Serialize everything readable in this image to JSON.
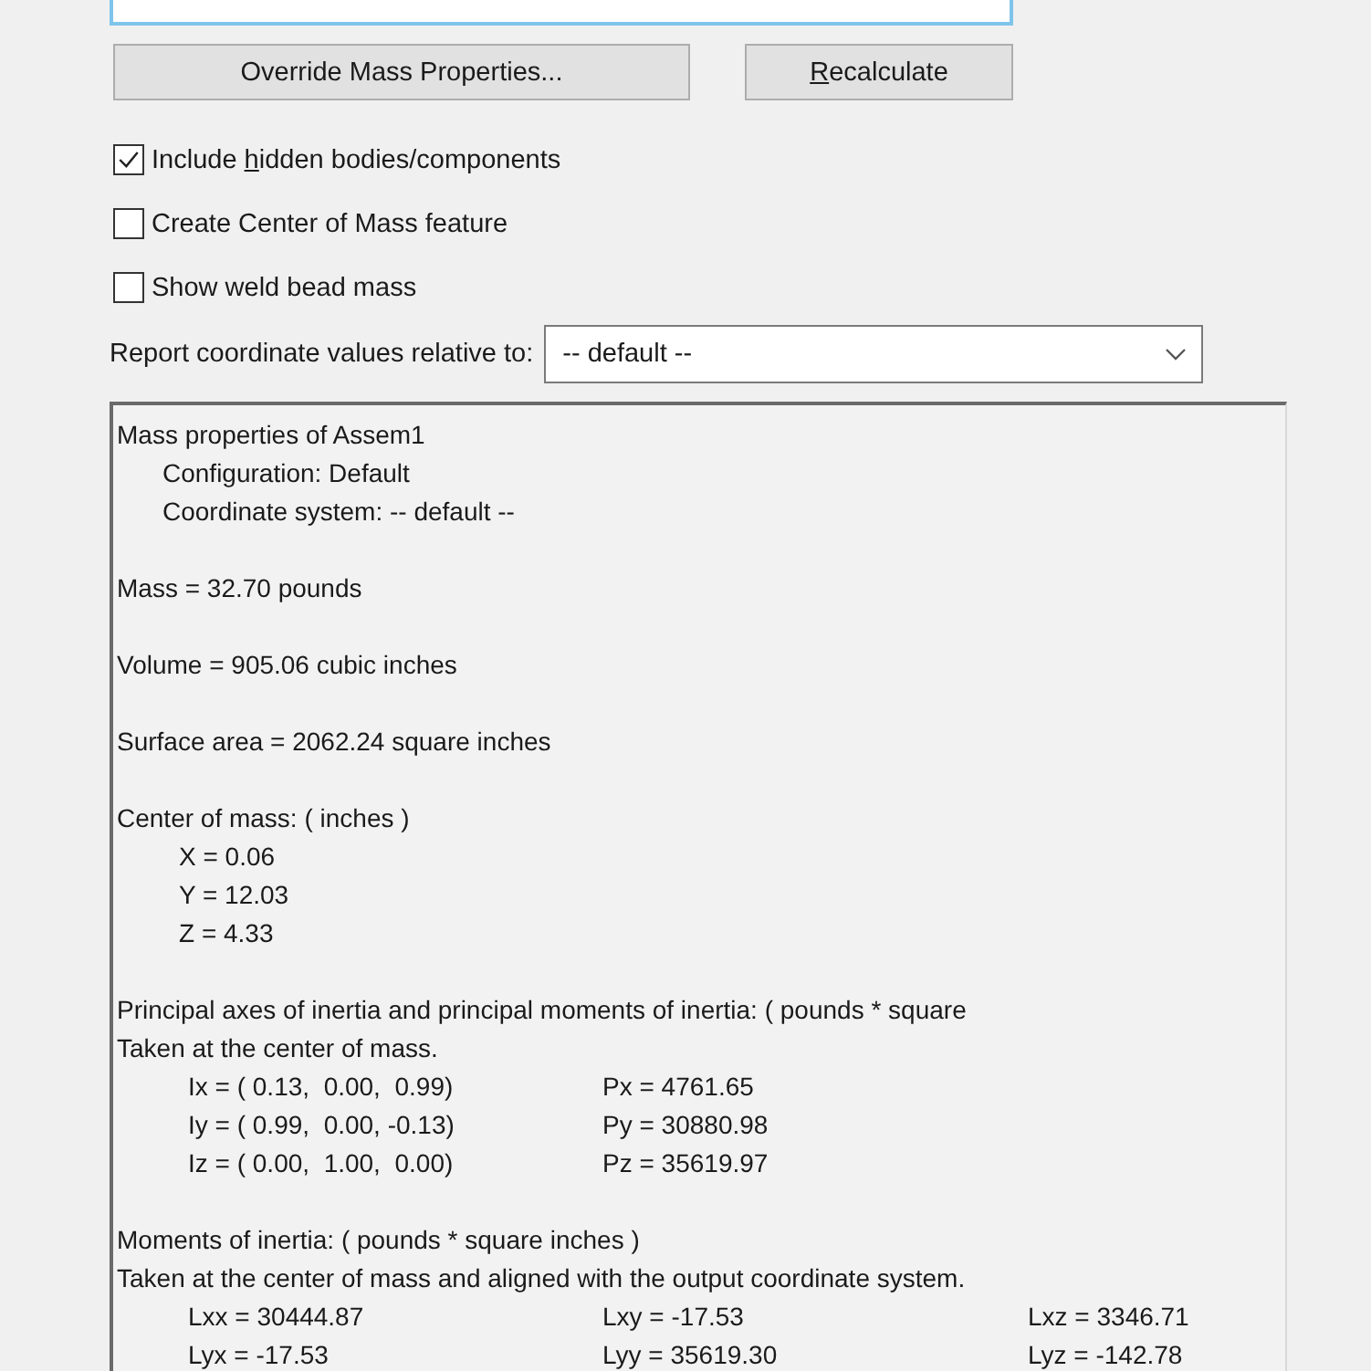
{
  "buttons": [
    {
      "text_before": "Override Mass Properties...",
      "kind": "wide"
    },
    {
      "mnemonic": "R",
      "text_after": "ecalculate",
      "kind": "narrow"
    }
  ],
  "options": [
    {
      "text_before": "Include ",
      "mnemonic": "h",
      "text_after": "idden bodies/components",
      "checked": true
    },
    {
      "text_before": "Create Center of Mass feature",
      "checked": false
    },
    {
      "text_before": "Show weld bead mass",
      "checked": false
    }
  ],
  "coordinate_select": {
    "label": "Report coordinate values relative to:",
    "value": "-- default --"
  },
  "results": [
    {
      "kind": "line",
      "text": "Mass properties of Assem1"
    },
    {
      "kind": "sub",
      "text": "Configuration: Default"
    },
    {
      "kind": "sub",
      "text": "Coordinate system: -- default --"
    },
    {
      "kind": "blank"
    },
    {
      "kind": "line",
      "text": "Mass = 32.70 pounds"
    },
    {
      "kind": "blank"
    },
    {
      "kind": "line",
      "text": "Volume = 905.06 cubic inches"
    },
    {
      "kind": "blank"
    },
    {
      "kind": "line",
      "text": "Surface area = 2062.24 square inches"
    },
    {
      "kind": "blank"
    },
    {
      "kind": "line",
      "text": "Center of mass: ( inches )"
    },
    {
      "kind": "value",
      "text": "X = 0.06"
    },
    {
      "kind": "value",
      "text": "Y = 12.03"
    },
    {
      "kind": "value",
      "text": "Z = 4.33"
    },
    {
      "kind": "blank"
    },
    {
      "kind": "line",
      "text": "Principal axes of inertia and principal moments of inertia: ( pounds * square"
    },
    {
      "kind": "line",
      "text": "Taken at the center of mass."
    },
    {
      "kind": "row",
      "cells": [
        "Ix = ( 0.13,  0.00,  0.99)",
        "Px = 4761.65"
      ]
    },
    {
      "kind": "row",
      "cells": [
        "Iy = ( 0.99,  0.00, -0.13)",
        "Py = 30880.98"
      ]
    },
    {
      "kind": "row",
      "cells": [
        "Iz = ( 0.00,  1.00,  0.00)",
        "Pz = 35619.97"
      ]
    },
    {
      "kind": "blank"
    },
    {
      "kind": "line",
      "text": "Moments of inertia: ( pounds * square inches )"
    },
    {
      "kind": "line",
      "text": "Taken at the center of mass and aligned with the output coordinate system."
    },
    {
      "kind": "row",
      "cells": [
        "Lxx = 30444.87",
        "Lxy = -17.53",
        "Lxz = 3346.71"
      ]
    },
    {
      "kind": "row",
      "cells": [
        "Lyx = -17.53",
        "Lyy = 35619.30",
        "Lyz = -142.78"
      ]
    }
  ]
}
